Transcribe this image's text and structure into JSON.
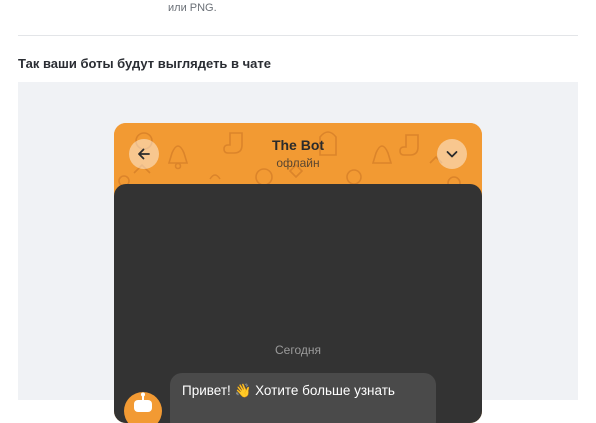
{
  "top_note": "или PNG.",
  "section_title": "Так ваши боты будут выглядеть в чате",
  "preview": {
    "bot_name": "The Bot",
    "bot_status": "офлайн",
    "date_label": "Сегодня",
    "message": "Привет! 👋 Хотите больше узнать",
    "header_color": "#f29a33",
    "chat_background": "#333333",
    "bubble_color": "#4a4a4a"
  },
  "icons": {
    "back": "arrow-left-icon",
    "menu": "chevron-down-icon",
    "avatar": "bot-avatar-icon"
  }
}
